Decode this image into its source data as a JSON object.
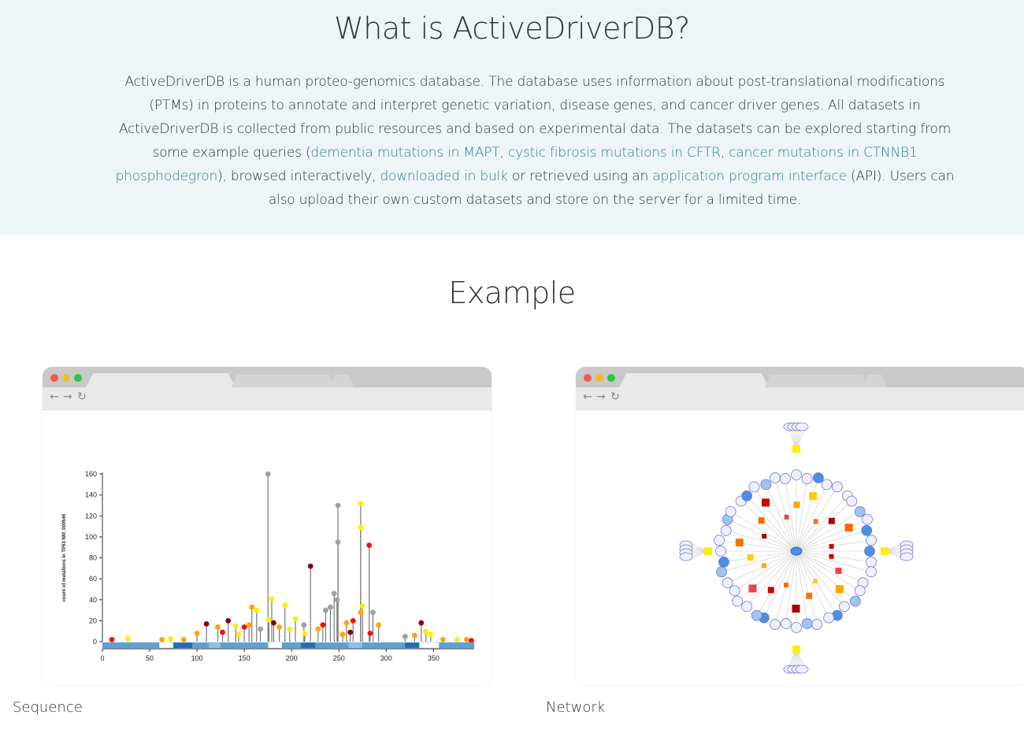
{
  "intro": {
    "title": "What is ActiveDriverDB?",
    "p1": "ActiveDriverDB is a human proteo-genomics database. The database uses information about post-translational modifications (PTMs) in proteins to annotate and interpret genetic variation, disease genes, and cancer driver genes. All datasets in ActiveDriverDB is collected from public resources and based on experimental data. The datasets can be explored starting from some example queries (",
    "link1": "dementia mutations in MAPT",
    "sep1": ", ",
    "link2": "cystic fibrosis mutations in CFTR",
    "sep2": ", ",
    "link3": "cancer mutations in CTNNB1 phosphodegron",
    "p2": "), browsed interactively, ",
    "link4": "downloaded in bulk",
    "p3": " or retrieved using an ",
    "link5": "application program interface",
    "p4": " (API). Users can also upload their own custom datasets and store on the server for a limited time."
  },
  "example": {
    "title": "Example",
    "caption_sequence": "Sequence",
    "caption_network": "Network"
  },
  "browser": {
    "dot_colors": [
      "#ee5a52",
      "#f4bb2e",
      "#2bc840"
    ],
    "back_icon": "←",
    "forward_icon": "→",
    "reload_icon": "↻"
  },
  "chart_data": {
    "type": "scatter",
    "ylabel": "count of mutations in TP53 NM_000546",
    "yticks": [
      0,
      20,
      40,
      60,
      80,
      100,
      120,
      140,
      160
    ],
    "xticks": [
      0,
      50,
      100,
      150,
      200,
      250,
      300,
      350
    ],
    "xlim": [
      0,
      393
    ],
    "ylim": [
      0,
      160
    ],
    "needles": [
      {
        "x": 175,
        "y": 160,
        "color": "#a0a0a0"
      },
      {
        "x": 249,
        "y": 130,
        "color": "#a0a0a0"
      },
      {
        "x": 249,
        "y": 95,
        "color": "#a0a0a0"
      },
      {
        "x": 273,
        "y": 132,
        "color": "#ffee00"
      },
      {
        "x": 273,
        "y": 109,
        "color": "#ffee00"
      },
      {
        "x": 282,
        "y": 92,
        "color": "#ee1111"
      },
      {
        "x": 220,
        "y": 72,
        "color": "#8b0000"
      },
      {
        "x": 245,
        "y": 46,
        "color": "#a0a0a0"
      },
      {
        "x": 179,
        "y": 41,
        "color": "#ffee00"
      },
      {
        "x": 158,
        "y": 33,
        "color": "#ffa500"
      },
      {
        "x": 163,
        "y": 30,
        "color": "#ffee00"
      },
      {
        "x": 193,
        "y": 35,
        "color": "#ffee00"
      },
      {
        "x": 236,
        "y": 30,
        "color": "#a0a0a0"
      },
      {
        "x": 241,
        "y": 33,
        "color": "#a0a0a0"
      },
      {
        "x": 248,
        "y": 40,
        "color": "#a0a0a0"
      },
      {
        "x": 273,
        "y": 28,
        "color": "#ffa500"
      },
      {
        "x": 275,
        "y": 34,
        "color": "#ffee00"
      },
      {
        "x": 286,
        "y": 28,
        "color": "#a0a0a0"
      },
      {
        "x": 133,
        "y": 20,
        "color": "#8b0000"
      },
      {
        "x": 110,
        "y": 17,
        "color": "#8b0000"
      },
      {
        "x": 122,
        "y": 14,
        "color": "#ffa500"
      },
      {
        "x": 141,
        "y": 15,
        "color": "#ffee00"
      },
      {
        "x": 150,
        "y": 14,
        "color": "#ee1111"
      },
      {
        "x": 155,
        "y": 16,
        "color": "#ffa500"
      },
      {
        "x": 167,
        "y": 12,
        "color": "#a0a0a0"
      },
      {
        "x": 176,
        "y": 21,
        "color": "#ffee00"
      },
      {
        "x": 181,
        "y": 18,
        "color": "#8b0000"
      },
      {
        "x": 187,
        "y": 14,
        "color": "#ffa500"
      },
      {
        "x": 198,
        "y": 12,
        "color": "#ffee00"
      },
      {
        "x": 204,
        "y": 22,
        "color": "#ffee00"
      },
      {
        "x": 213,
        "y": 16,
        "color": "#a0a0a0"
      },
      {
        "x": 228,
        "y": 12,
        "color": "#ffa500"
      },
      {
        "x": 233,
        "y": 16,
        "color": "#ee1111"
      },
      {
        "x": 258,
        "y": 18,
        "color": "#ffa500"
      },
      {
        "x": 265,
        "y": 20,
        "color": "#ee1111"
      },
      {
        "x": 292,
        "y": 16,
        "color": "#ffa500"
      },
      {
        "x": 337,
        "y": 18,
        "color": "#8b0000"
      },
      {
        "x": 342,
        "y": 10,
        "color": "#ffee00"
      },
      {
        "x": 100,
        "y": 8,
        "color": "#ffa500"
      },
      {
        "x": 127,
        "y": 9,
        "color": "#ee1111"
      },
      {
        "x": 144,
        "y": 7,
        "color": "#ffee00"
      },
      {
        "x": 214,
        "y": 8,
        "color": "#ffee00"
      },
      {
        "x": 254,
        "y": 7,
        "color": "#ffa500"
      },
      {
        "x": 262,
        "y": 9,
        "color": "#8b0000"
      },
      {
        "x": 283,
        "y": 8,
        "color": "#ee1111"
      },
      {
        "x": 320,
        "y": 5,
        "color": "#a0a0a0"
      },
      {
        "x": 330,
        "y": 6,
        "color": "#ffa500"
      },
      {
        "x": 347,
        "y": 7,
        "color": "#ffee00"
      },
      {
        "x": 27,
        "y": 3,
        "color": "#ffee00"
      },
      {
        "x": 10,
        "y": 2,
        "color": "#ee1111"
      },
      {
        "x": 63,
        "y": 2,
        "color": "#ffa500"
      },
      {
        "x": 72,
        "y": 3,
        "color": "#ffee00"
      },
      {
        "x": 86,
        "y": 2,
        "color": "#ffa500"
      },
      {
        "x": 360,
        "y": 2,
        "color": "#ffa500"
      },
      {
        "x": 375,
        "y": 2,
        "color": "#ffee00"
      },
      {
        "x": 385,
        "y": 2,
        "color": "#ffa500"
      },
      {
        "x": 390,
        "y": 1,
        "color": "#ee1111"
      }
    ],
    "domain_track": [
      {
        "from": 0,
        "to": 60,
        "color": "#5ba3d6"
      },
      {
        "from": 60,
        "to": 75,
        "color": "#ffffff"
      },
      {
        "from": 75,
        "to": 95,
        "color": "#1f6fb5"
      },
      {
        "from": 95,
        "to": 112,
        "color": "#5ba3d6"
      },
      {
        "from": 112,
        "to": 125,
        "color": "#8fc1e8"
      },
      {
        "from": 125,
        "to": 175,
        "color": "#5ba3d6"
      },
      {
        "from": 175,
        "to": 190,
        "color": "#ffffff"
      },
      {
        "from": 190,
        "to": 210,
        "color": "#5ba3d6"
      },
      {
        "from": 210,
        "to": 225,
        "color": "#1f6fb5"
      },
      {
        "from": 225,
        "to": 260,
        "color": "#5ba3d6"
      },
      {
        "from": 260,
        "to": 275,
        "color": "#8fc1e8"
      },
      {
        "from": 275,
        "to": 320,
        "color": "#5ba3d6"
      },
      {
        "from": 320,
        "to": 335,
        "color": "#1f6fb5"
      },
      {
        "from": 335,
        "to": 356,
        "color": "#ffffff"
      },
      {
        "from": 356,
        "to": 393,
        "color": "#5ba3d6"
      }
    ]
  }
}
